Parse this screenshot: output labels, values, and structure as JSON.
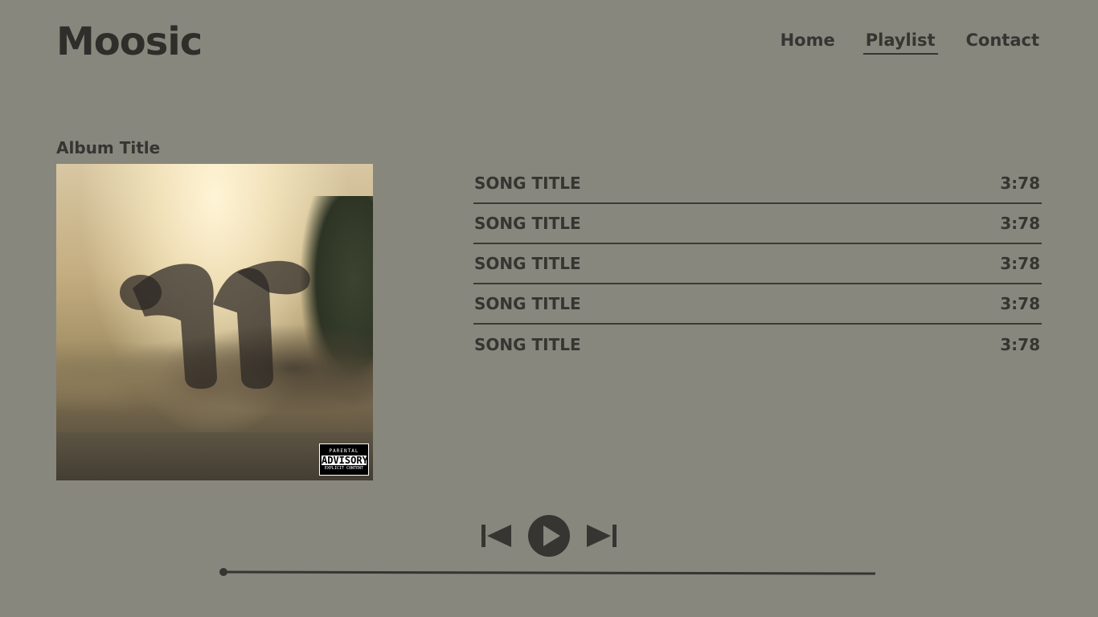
{
  "header": {
    "logo": "Moosic",
    "nav": [
      {
        "label": "Home",
        "active": false
      },
      {
        "label": "Playlist",
        "active": true
      },
      {
        "label": "Contact",
        "active": false
      }
    ]
  },
  "album": {
    "title": "Album Title",
    "cover_advisory": [
      "PARENTAL",
      "ADVISORY",
      "EXPLICIT CONTENT"
    ]
  },
  "tracks": [
    {
      "title": "SONG TITLE",
      "duration": "3:78"
    },
    {
      "title": "SONG TITLE",
      "duration": "3:78"
    },
    {
      "title": "SONG TITLE",
      "duration": "3:78"
    },
    {
      "title": "SONG TITLE",
      "duration": "3:78"
    },
    {
      "title": "SONG TITLE",
      "duration": "3:78"
    }
  ],
  "player": {
    "controls": [
      "skip-back-icon",
      "play-icon",
      "skip-forward-icon"
    ],
    "progress": 0
  },
  "colors": {
    "background": "#87877d",
    "text": "#363532"
  }
}
